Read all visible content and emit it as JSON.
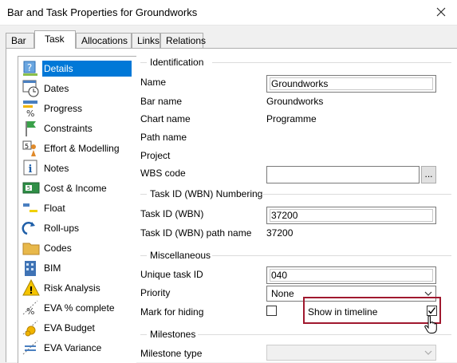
{
  "window": {
    "title": "Bar and Task Properties for Groundworks"
  },
  "tabs": [
    {
      "label": "Bar",
      "active": false
    },
    {
      "label": "Task",
      "active": true
    },
    {
      "label": "Allocations",
      "active": false
    },
    {
      "label": "Links",
      "active": false
    },
    {
      "label": "Relations",
      "active": false
    }
  ],
  "nav": {
    "items": [
      {
        "label": "Details",
        "icon": "details-icon",
        "selected": true
      },
      {
        "label": "Dates",
        "icon": "calendar-clock-icon"
      },
      {
        "label": "Progress",
        "icon": "percent-bars-icon"
      },
      {
        "label": "Constraints",
        "icon": "flag-icon"
      },
      {
        "label": "Effort & Modelling",
        "icon": "effort-icon"
      },
      {
        "label": "Notes",
        "icon": "info-icon"
      },
      {
        "label": "Cost & Income",
        "icon": "banknote-icon"
      },
      {
        "label": "Float",
        "icon": "float-bars-icon"
      },
      {
        "label": "Roll-ups",
        "icon": "rollup-arrow-icon"
      },
      {
        "label": "Codes",
        "icon": "folder-icon"
      },
      {
        "label": "BIM",
        "icon": "building-icon"
      },
      {
        "label": "Risk Analysis",
        "icon": "warning-icon"
      },
      {
        "label": "EVA % complete",
        "icon": "eva-percent-icon"
      },
      {
        "label": "EVA Budget",
        "icon": "eva-coins-icon"
      },
      {
        "label": "EVA Variance",
        "icon": "eva-variance-icon"
      }
    ]
  },
  "identification": {
    "title": "Identification",
    "name_label": "Name",
    "name_value": "Groundworks",
    "bar_name_label": "Bar name",
    "bar_name_value": "Groundworks",
    "chart_name_label": "Chart name",
    "chart_name_value": "Programme",
    "path_name_label": "Path name",
    "project_label": "Project",
    "wbs_label": "WBS code",
    "wbs_value": "",
    "wbs_button": "..."
  },
  "wbn": {
    "title": "Task ID (WBN) Numbering",
    "task_id_label": "Task ID (WBN)",
    "task_id_value": "37200",
    "path_label": "Task ID (WBN) path name",
    "path_value": "37200"
  },
  "misc": {
    "title": "Miscellaneous",
    "unique_label": "Unique task ID",
    "unique_value": "040",
    "priority_label": "Priority",
    "priority_value": "None",
    "hide_label": "Mark for hiding",
    "hide_checked": false,
    "timeline_label": "Show in timeline",
    "timeline_checked": true
  },
  "milestones": {
    "title": "Milestones",
    "type_label": "Milestone type",
    "type_value": ""
  },
  "colors": {
    "accent": "#0078d7",
    "highlight": "#a0182e"
  }
}
